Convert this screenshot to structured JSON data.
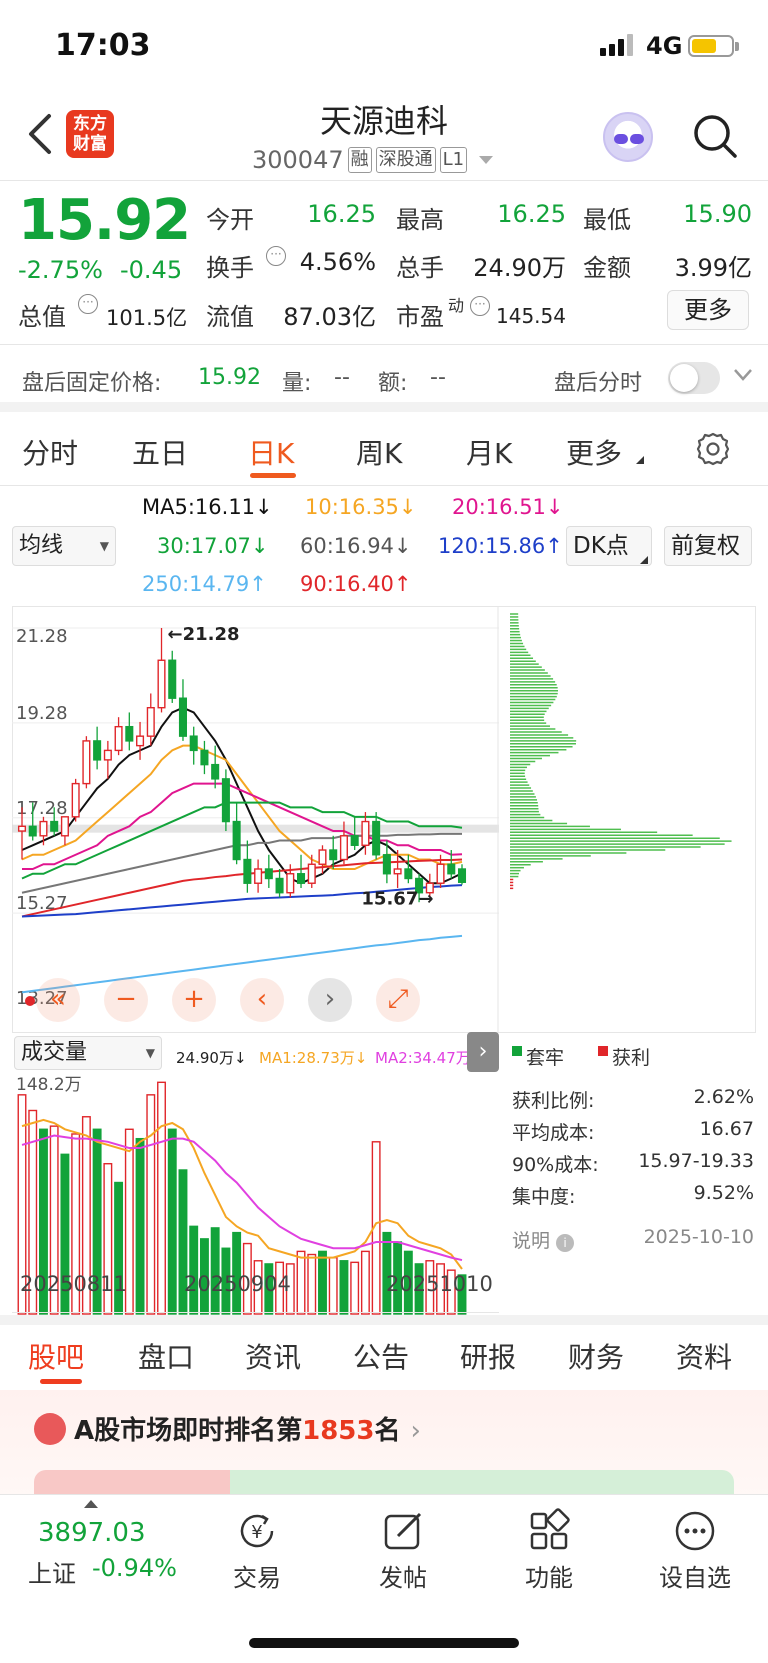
{
  "status": {
    "time": "17:03",
    "network": "4G"
  },
  "header": {
    "logo_text": "东方\n财富",
    "stock_name": "天源迪科",
    "code": "300047",
    "tags": [
      "融",
      "深股通",
      "L1"
    ]
  },
  "quote": {
    "price": "15.92",
    "change_pct": "-2.75%",
    "change_abs": "-0.45",
    "open_label": "今开",
    "open": "16.25",
    "high_label": "最高",
    "high": "16.25",
    "low_label": "最低",
    "low": "15.90",
    "turnover_label": "换手",
    "turnover": "4.56%",
    "volume_label": "总手",
    "volume": "24.90万",
    "amount_label": "金额",
    "amount": "3.99亿",
    "mktcap_label": "总值",
    "mktcap": "101.5亿",
    "float_label": "流值",
    "float": "87.03亿",
    "pe_label": "市盈",
    "pe_sup": "动",
    "pe": "145.54",
    "more_label": "更多"
  },
  "after_hours": {
    "label": "盘后固定价格:",
    "price": "15.92",
    "vol_label": "量:",
    "vol": "--",
    "amt_label": "额:",
    "amt": "--",
    "toggle_label": "盘后分时"
  },
  "period_tabs": [
    "分时",
    "五日",
    "日K",
    "周K",
    "月K",
    "更多"
  ],
  "ma_select": "均线",
  "ma": {
    "ma5": "MA5:16.11↓",
    "ma10": "10:16.35↓",
    "ma20": "20:16.51↓",
    "ma30": "30:17.07↓",
    "ma60": "60:16.94↓",
    "ma120": "120:15.86↑",
    "ma250": "250:14.79↑",
    "ma90": "90:16.40↑"
  },
  "buttons": {
    "dk": "DK点",
    "adjust": "前复权"
  },
  "colors": {
    "up": "#e0262a",
    "down": "#12a33a",
    "accent": "#ef5a1f"
  },
  "chart_data": [
    {
      "type": "candlestick",
      "y_ticks": [
        "21.28",
        "19.28",
        "17.28",
        "15.27",
        "13.27"
      ],
      "annotations": [
        "←21.28",
        "15.67→"
      ],
      "candles": [
        [
          17.0,
          17.5,
          16.4,
          17.1
        ],
        [
          17.1,
          17.6,
          16.8,
          16.9
        ],
        [
          16.9,
          17.3,
          16.7,
          17.2
        ],
        [
          17.2,
          17.5,
          16.9,
          17.0
        ],
        [
          16.9,
          17.3,
          16.7,
          17.3
        ],
        [
          17.3,
          18.1,
          17.2,
          18.0
        ],
        [
          18.0,
          19.0,
          17.9,
          18.9
        ],
        [
          18.9,
          19.2,
          18.3,
          18.5
        ],
        [
          18.5,
          18.9,
          18.1,
          18.7
        ],
        [
          18.7,
          19.4,
          18.6,
          19.2
        ],
        [
          19.2,
          19.5,
          18.7,
          18.9
        ],
        [
          18.8,
          19.3,
          18.5,
          19.0
        ],
        [
          19.0,
          19.9,
          18.8,
          19.6
        ],
        [
          19.6,
          21.28,
          19.5,
          20.6
        ],
        [
          20.6,
          20.8,
          19.7,
          19.8
        ],
        [
          19.8,
          20.2,
          18.9,
          19.0
        ],
        [
          19.0,
          19.2,
          18.4,
          18.7
        ],
        [
          18.7,
          18.9,
          18.2,
          18.4
        ],
        [
          18.4,
          18.8,
          17.9,
          18.1
        ],
        [
          18.1,
          18.3,
          17.0,
          17.2
        ],
        [
          17.2,
          17.6,
          16.3,
          16.4
        ],
        [
          16.4,
          16.8,
          15.7,
          15.9
        ],
        [
          15.9,
          16.4,
          15.7,
          16.2
        ],
        [
          16.2,
          16.5,
          15.8,
          16.0
        ],
        [
          16.0,
          16.2,
          15.6,
          15.7
        ],
        [
          15.7,
          16.3,
          15.6,
          16.1
        ],
        [
          16.1,
          16.5,
          15.8,
          15.9
        ],
        [
          15.9,
          16.5,
          15.8,
          16.3
        ],
        [
          16.3,
          16.7,
          16.1,
          16.6
        ],
        [
          16.6,
          16.9,
          16.2,
          16.4
        ],
        [
          16.4,
          17.2,
          16.3,
          16.9
        ],
        [
          16.9,
          17.3,
          16.6,
          16.7
        ],
        [
          16.7,
          17.4,
          16.5,
          17.2
        ],
        [
          17.2,
          17.4,
          16.4,
          16.5
        ],
        [
          16.5,
          16.8,
          15.9,
          16.1
        ],
        [
          16.1,
          16.6,
          15.8,
          16.2
        ],
        [
          16.2,
          16.5,
          15.9,
          16.0
        ],
        [
          16.0,
          16.1,
          15.5,
          15.7
        ],
        [
          15.7,
          16.1,
          15.6,
          15.9
        ],
        [
          15.9,
          16.5,
          15.8,
          16.3
        ],
        [
          16.3,
          16.6,
          16.0,
          16.1
        ],
        [
          16.2,
          16.3,
          15.87,
          15.92
        ]
      ],
      "ma_lines": {
        "ma5": [
          16.6,
          16.7,
          16.8,
          16.9,
          17.0,
          17.3,
          17.6,
          17.9,
          18.1,
          18.4,
          18.6,
          18.7,
          18.8,
          19.2,
          19.5,
          19.6,
          19.5,
          19.2,
          18.9,
          18.5,
          18.0,
          17.5,
          17.0,
          16.6,
          16.3,
          16.0,
          15.9,
          16.0,
          16.1,
          16.3,
          16.4,
          16.5,
          16.7,
          16.8,
          16.7,
          16.5,
          16.3,
          16.1,
          15.9,
          15.9,
          16.0,
          16.11
        ],
        "ma10": [
          16.4,
          16.5,
          16.5,
          16.6,
          16.7,
          16.8,
          17.0,
          17.2,
          17.4,
          17.6,
          17.8,
          18.0,
          18.2,
          18.5,
          18.7,
          18.8,
          18.8,
          18.7,
          18.6,
          18.5,
          18.2,
          17.9,
          17.6,
          17.3,
          17.0,
          16.8,
          16.6,
          16.4,
          16.3,
          16.2,
          16.2,
          16.2,
          16.3,
          16.4,
          16.5,
          16.5,
          16.5,
          16.4,
          16.4,
          16.3,
          16.3,
          16.35
        ],
        "ma20": [
          16.2,
          16.2,
          16.3,
          16.3,
          16.4,
          16.5,
          16.6,
          16.7,
          16.9,
          17.0,
          17.1,
          17.3,
          17.4,
          17.6,
          17.8,
          17.9,
          18.0,
          18.0,
          18.0,
          18.0,
          17.9,
          17.8,
          17.7,
          17.6,
          17.5,
          17.4,
          17.3,
          17.2,
          17.1,
          17.0,
          17.0,
          16.9,
          16.9,
          16.8,
          16.8,
          16.7,
          16.7,
          16.6,
          16.6,
          16.6,
          16.5,
          16.51
        ],
        "ma30": [
          16.0,
          16.1,
          16.1,
          16.2,
          16.3,
          16.3,
          16.4,
          16.5,
          16.6,
          16.7,
          16.8,
          16.9,
          17.0,
          17.1,
          17.2,
          17.3,
          17.4,
          17.5,
          17.5,
          17.6,
          17.6,
          17.6,
          17.6,
          17.6,
          17.6,
          17.5,
          17.5,
          17.5,
          17.4,
          17.4,
          17.4,
          17.3,
          17.3,
          17.3,
          17.2,
          17.2,
          17.2,
          17.1,
          17.1,
          17.1,
          17.1,
          17.07
        ],
        "ma60": [
          15.7,
          15.75,
          15.8,
          15.85,
          15.9,
          15.95,
          16.0,
          16.05,
          16.1,
          16.15,
          16.2,
          16.25,
          16.3,
          16.35,
          16.4,
          16.45,
          16.5,
          16.55,
          16.6,
          16.65,
          16.7,
          16.7,
          16.75,
          16.75,
          16.8,
          16.8,
          16.8,
          16.85,
          16.85,
          16.85,
          16.9,
          16.9,
          16.9,
          16.9,
          16.9,
          16.92,
          16.92,
          16.93,
          16.93,
          16.94,
          16.94,
          16.94
        ],
        "ma90": [
          15.2,
          15.25,
          15.3,
          15.35,
          15.4,
          15.45,
          15.5,
          15.55,
          15.6,
          15.65,
          15.7,
          15.75,
          15.8,
          15.85,
          15.9,
          15.95,
          15.98,
          16.0,
          16.03,
          16.05,
          16.08,
          16.1,
          16.12,
          16.14,
          16.16,
          16.18,
          16.2,
          16.22,
          16.24,
          16.26,
          16.28,
          16.3,
          16.32,
          16.33,
          16.34,
          16.35,
          16.36,
          16.37,
          16.38,
          16.39,
          16.39,
          16.4
        ],
        "ma120": [
          15.2,
          15.21,
          15.22,
          15.23,
          15.24,
          15.25,
          15.27,
          15.29,
          15.31,
          15.33,
          15.35,
          15.37,
          15.39,
          15.41,
          15.43,
          15.45,
          15.47,
          15.49,
          15.51,
          15.53,
          15.55,
          15.57,
          15.58,
          15.59,
          15.6,
          15.61,
          15.62,
          15.63,
          15.64,
          15.65,
          15.67,
          15.69,
          15.7,
          15.72,
          15.74,
          15.76,
          15.78,
          15.8,
          15.82,
          15.83,
          15.85,
          15.86
        ],
        "ma250": [
          13.6,
          13.63,
          13.66,
          13.69,
          13.72,
          13.75,
          13.78,
          13.81,
          13.84,
          13.87,
          13.9,
          13.93,
          13.96,
          13.99,
          14.02,
          14.05,
          14.08,
          14.11,
          14.14,
          14.17,
          14.2,
          14.23,
          14.26,
          14.29,
          14.32,
          14.35,
          14.38,
          14.41,
          14.44,
          14.47,
          14.5,
          14.53,
          14.56,
          14.59,
          14.61,
          14.64,
          14.67,
          14.7,
          14.72,
          14.75,
          14.77,
          14.79
        ]
      }
    },
    {
      "type": "bar",
      "title": "成交量",
      "y_max_label": "148.2万",
      "x_labels": [
        "20250811",
        "20250904",
        "20251010"
      ],
      "legend": [
        "24.90万↓",
        "MA1:28.73万↓",
        "MA2:34.47万↓"
      ],
      "values": [
        140,
        130,
        118,
        120,
        102,
        115,
        126,
        118,
        96,
        84,
        118,
        112,
        140,
        148,
        118,
        92,
        56,
        48,
        55,
        42,
        52,
        45,
        34,
        32,
        33,
        32,
        40,
        38,
        40,
        36,
        34,
        33,
        40,
        110,
        52,
        46,
        40,
        32,
        34,
        32,
        28,
        24.9
      ],
      "up": [
        1,
        1,
        0,
        1,
        0,
        1,
        1,
        0,
        1,
        0,
        1,
        0,
        1,
        1,
        0,
        0,
        0,
        0,
        0,
        0,
        0,
        1,
        1,
        0,
        1,
        1,
        1,
        1,
        0,
        1,
        0,
        1,
        1,
        1,
        0,
        0,
        0,
        0,
        1,
        1,
        1,
        0
      ],
      "ma1": [
        120,
        122,
        124,
        122,
        118,
        116,
        114,
        110,
        108,
        106,
        104,
        110,
        114,
        120,
        122,
        118,
        106,
        90,
        76,
        62,
        56,
        52,
        50,
        42,
        40,
        38,
        36,
        36,
        36,
        36,
        38,
        40,
        46,
        58,
        60,
        58,
        50,
        46,
        44,
        42,
        38,
        28.73
      ],
      "ma2": [
        108,
        110,
        112,
        114,
        113,
        112,
        112,
        111,
        110,
        108,
        106,
        106,
        108,
        110,
        112,
        112,
        110,
        104,
        98,
        90,
        84,
        76,
        68,
        62,
        56,
        52,
        48,
        46,
        44,
        42,
        42,
        42,
        44,
        46,
        46,
        46,
        44,
        42,
        40,
        38,
        36,
        34.47
      ]
    },
    {
      "type": "chip-distribution",
      "legend": [
        "套牢",
        "获利"
      ]
    }
  ],
  "chip_stats": {
    "profit_ratio_label": "获利比例:",
    "profit_ratio": "2.62%",
    "avg_cost_label": "平均成本:",
    "avg_cost": "16.67",
    "cost90_label": "90%成本:",
    "cost90": "15.97-19.33",
    "concentration_label": "集中度:",
    "concentration": "9.52%",
    "note_label": "说明",
    "date": "2025-10-10"
  },
  "chart_controls": [
    "«",
    "−",
    "+",
    "‹",
    "›",
    "⤢"
  ],
  "vol_select": "成交量",
  "bottom_tabs": [
    "股吧",
    "盘口",
    "资讯",
    "公告",
    "研报",
    "财务",
    "资料"
  ],
  "banner": {
    "prefix": "A股市场即时排名第",
    "rank": "1853",
    "suffix": "名"
  },
  "tabbar": {
    "index_value": "3897.03",
    "index_name": "上证",
    "index_change": "-0.94%",
    "items": [
      "交易",
      "发帖",
      "功能",
      "设自选"
    ]
  }
}
